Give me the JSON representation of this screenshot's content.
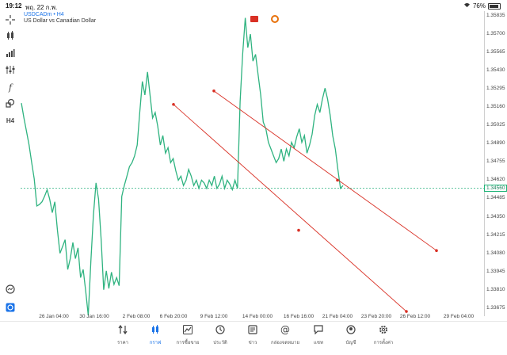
{
  "status_bar": {
    "time": "19:12",
    "date": "พฤ. 22 ก.พ.",
    "battery": "76%"
  },
  "chart": {
    "symbol": "USDCADm • H4",
    "description": "US Dollar vs Canadian Dollar",
    "current_price": "1.34560"
  },
  "chart_data": {
    "type": "line",
    "price_ticks": [
      "1.35835",
      "1.35700",
      "1.35565",
      "1.35430",
      "1.35295",
      "1.35160",
      "1.35025",
      "1.34890",
      "1.34755",
      "1.34620",
      "1.34485",
      "1.34350",
      "1.34215",
      "1.34080",
      "1.33945",
      "1.33810",
      "1.33675"
    ],
    "time_ticks": [
      "26 Jan 04:00",
      "30 Jan 16:00",
      "2 Feb 08:00",
      "6 Feb 20:00",
      "9 Feb 12:00",
      "14 Feb 00:00",
      "16 Feb 16:00",
      "21 Feb 04:00",
      "23 Feb 20:00",
      "26 Feb 12:00",
      "29 Feb 04:00"
    ],
    "colors": {
      "line": "#2fb380",
      "trend": "#d93025"
    },
    "series": [
      {
        "values": [
          1.3519,
          1.3508,
          1.3498,
          1.3488,
          1.3475,
          1.3463,
          1.3443,
          1.3444,
          1.3446,
          1.345,
          1.3455,
          1.3448,
          1.3438,
          1.3446,
          1.3425,
          1.3408,
          1.3413,
          1.3418,
          1.3396,
          1.3404,
          1.3416,
          1.3404,
          1.3412,
          1.339,
          1.3396,
          1.338,
          1.3362,
          1.3402,
          1.3436,
          1.346,
          1.3448,
          1.3418,
          1.3381,
          1.3395,
          1.3382,
          1.3394,
          1.3385,
          1.339,
          1.3384,
          1.345,
          1.3458,
          1.3465,
          1.3472,
          1.3475,
          1.348,
          1.3488,
          1.3512,
          1.3535,
          1.3525,
          1.3542,
          1.3525,
          1.3508,
          1.3512,
          1.3502,
          1.3488,
          1.3495,
          1.3482,
          1.3486,
          1.3475,
          1.3478,
          1.3469,
          1.3462,
          1.3465,
          1.3458,
          1.3462,
          1.347,
          1.3465,
          1.3458,
          1.3462,
          1.3456,
          1.3462,
          1.346,
          1.3456,
          1.3462,
          1.3458,
          1.3465,
          1.3456,
          1.3459,
          1.3465,
          1.3456,
          1.3462,
          1.3459,
          1.3455,
          1.3462,
          1.3456,
          1.352,
          1.3555,
          1.3582,
          1.356,
          1.357,
          1.355,
          1.3555,
          1.354,
          1.3525,
          1.3505,
          1.35,
          1.349,
          1.3485,
          1.348,
          1.3475,
          1.3478,
          1.3485,
          1.3476,
          1.3485,
          1.348,
          1.349,
          1.3486,
          1.3494,
          1.35,
          1.349,
          1.3495,
          1.3482,
          1.3488,
          1.3496,
          1.351,
          1.3518,
          1.3512,
          1.3522,
          1.353,
          1.3522,
          1.351,
          1.3495,
          1.3485,
          1.347,
          1.3456,
          1.3458
        ]
      }
    ],
    "trendlines": [
      {
        "start": [
          "6 Feb 20:00",
          1.3518
        ],
        "mid": [
          "16 Feb 16:00",
          1.3425
        ],
        "end": [
          "24 Feb 16:00",
          1.3365
        ]
      },
      {
        "start": [
          "9 Feb 12:00",
          1.3528
        ],
        "mid": [
          "21 Feb 04:00",
          1.3462
        ],
        "end": [
          "27 Feb 00:00",
          1.341
        ]
      }
    ],
    "ylim": [
      1.33615,
      1.3587
    ]
  },
  "toolbar": {
    "tools": [
      {
        "icon": "crosshair-icon"
      },
      {
        "icon": "chart-type-icon"
      },
      {
        "icon": "timeframe-icon"
      },
      {
        "icon": "indicators-icon"
      },
      {
        "icon": "function-icon"
      },
      {
        "icon": "objects-icon"
      },
      {
        "icon": "period-icon",
        "label": "H4"
      },
      {
        "icon": "zoom-icon"
      },
      {
        "icon": "chart-settings-icon"
      }
    ]
  },
  "bottom_nav": [
    {
      "label": "ราคา",
      "icon": "quotes-icon"
    },
    {
      "label": "กราฟ",
      "icon": "chart-icon",
      "active": true
    },
    {
      "label": "การซื้อขาย",
      "icon": "trade-icon"
    },
    {
      "label": "ประวัติ",
      "icon": "history-icon"
    },
    {
      "label": "ข่าว",
      "icon": "news-icon"
    },
    {
      "label": "กล่องจดหมาย",
      "icon": "mailbox-icon"
    },
    {
      "label": "แชท",
      "icon": "chat-icon"
    },
    {
      "label": "บัญชี",
      "icon": "accounts-icon"
    },
    {
      "label": "การตั้งค่า",
      "icon": "settings-icon"
    }
  ]
}
